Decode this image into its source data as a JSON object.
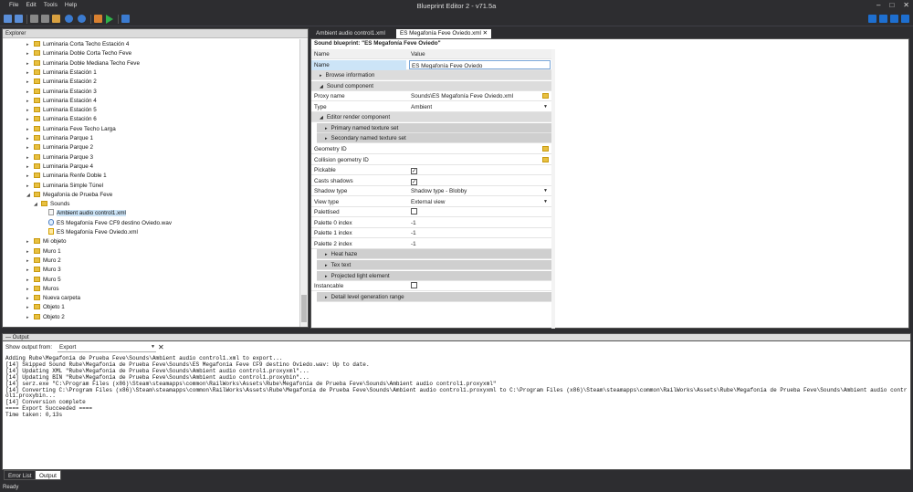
{
  "app": {
    "title": "Blueprint Editor 2 - v71.5a"
  },
  "menu": [
    "File",
    "Edit",
    "Tools",
    "Help"
  ],
  "explorer": {
    "title": "Explorer",
    "items": [
      {
        "label": "Luminaria Corta Techo Estación 4",
        "indent": 1,
        "type": "folder",
        "arrow": "▸"
      },
      {
        "label": "Luminaria Doble Corta Techo Feve",
        "indent": 1,
        "type": "folder",
        "arrow": "▸"
      },
      {
        "label": "Luminaria Doble Mediana Techo Feve",
        "indent": 1,
        "type": "folder",
        "arrow": "▸"
      },
      {
        "label": "Luminaria Estación 1",
        "indent": 1,
        "type": "folder",
        "arrow": "▸"
      },
      {
        "label": "Luminaria Estación 2",
        "indent": 1,
        "type": "folder",
        "arrow": "▸"
      },
      {
        "label": "Luminaria Estación 3",
        "indent": 1,
        "type": "folder",
        "arrow": "▸"
      },
      {
        "label": "Luminaria Estación 4",
        "indent": 1,
        "type": "folder",
        "arrow": "▸"
      },
      {
        "label": "Luminaria Estación 5",
        "indent": 1,
        "type": "folder",
        "arrow": "▸"
      },
      {
        "label": "Luminaria Estación 6",
        "indent": 1,
        "type": "folder",
        "arrow": "▸"
      },
      {
        "label": "Luminaria Feve Techo Larga",
        "indent": 1,
        "type": "folder",
        "arrow": "▸"
      },
      {
        "label": "Luminaria Parque 1",
        "indent": 1,
        "type": "folder",
        "arrow": "▸"
      },
      {
        "label": "Luminaria Parque 2",
        "indent": 1,
        "type": "folder",
        "arrow": "▸"
      },
      {
        "label": "Luminaria Parque 3",
        "indent": 1,
        "type": "folder",
        "arrow": "▸"
      },
      {
        "label": "Luminaria Parque 4",
        "indent": 1,
        "type": "folder",
        "arrow": "▸"
      },
      {
        "label": "Luminaria Renfe Doble 1",
        "indent": 1,
        "type": "folder",
        "arrow": "▸"
      },
      {
        "label": "Luminaria Simple Túnel",
        "indent": 1,
        "type": "folder",
        "arrow": "▸"
      },
      {
        "label": "Megafonía de Prueba Feve",
        "indent": 1,
        "type": "folder",
        "arrow": "◢"
      },
      {
        "label": "Sounds",
        "indent": 2,
        "type": "folder",
        "arrow": "◢"
      },
      {
        "label": "Ambient audio control1.xml",
        "indent": 3,
        "type": "file",
        "arrow": "",
        "selected": true
      },
      {
        "label": "ES Megafonía Feve CF9 destino Oviedo.wav",
        "indent": 3,
        "type": "wav",
        "arrow": ""
      },
      {
        "label": "ES Megafonía Feve Oviedo.xml",
        "indent": 3,
        "type": "xmlo",
        "arrow": ""
      },
      {
        "label": "Mi objeto",
        "indent": 1,
        "type": "folder",
        "arrow": "▸"
      },
      {
        "label": "Muro 1",
        "indent": 1,
        "type": "folder",
        "arrow": "▸"
      },
      {
        "label": "Muro 2",
        "indent": 1,
        "type": "folder",
        "arrow": "▸"
      },
      {
        "label": "Muro 3",
        "indent": 1,
        "type": "folder",
        "arrow": "▸"
      },
      {
        "label": "Muro 5",
        "indent": 1,
        "type": "folder",
        "arrow": "▸"
      },
      {
        "label": "Muros",
        "indent": 1,
        "type": "folder",
        "arrow": "▸"
      },
      {
        "label": "Nueva carpeta",
        "indent": 1,
        "type": "folder",
        "arrow": "▸"
      },
      {
        "label": "Objeto 1",
        "indent": 1,
        "type": "folder",
        "arrow": "▸"
      },
      {
        "label": "Objeto 2",
        "indent": 1,
        "type": "folder",
        "arrow": "▸"
      }
    ]
  },
  "tabs": [
    {
      "label": "Ambient audio control1.xml",
      "active": false
    },
    {
      "label": "ES Megafonía Feve Oviedo.xml",
      "active": true,
      "close": "✕"
    }
  ],
  "blueprint": {
    "header": "Sound blueprint: \"ES Megafonía Feve Oviedo\"",
    "col_name": "Name",
    "col_value": "Value",
    "rows": [
      {
        "kind": "prop",
        "name": "Name",
        "value": "ES Megafonía Feve Oviedo",
        "highlight": true
      },
      {
        "kind": "cat",
        "name": "Browse information",
        "arrow": "▸"
      },
      {
        "kind": "cat",
        "name": "Sound component",
        "arrow": "◢"
      },
      {
        "kind": "prop",
        "name": "Proxy name",
        "value": "Sounds\\ES Megafonía Feve Oviedo.xml",
        "icon": "folder"
      },
      {
        "kind": "prop",
        "name": "Type",
        "value": "Ambient",
        "dropdown": true
      },
      {
        "kind": "cat",
        "name": "Editor render component",
        "arrow": "◢"
      },
      {
        "kind": "subcat",
        "name": "Primary named texture set",
        "arrow": "▸"
      },
      {
        "kind": "subcat",
        "name": "Secondary named texture set",
        "arrow": "▸"
      },
      {
        "kind": "prop",
        "name": "Geometry ID",
        "value": "",
        "icon": "folder"
      },
      {
        "kind": "prop",
        "name": "Collision geometry ID",
        "value": "",
        "icon": "folder"
      },
      {
        "kind": "prop",
        "name": "Pickable",
        "checkbox": true,
        "checked": true
      },
      {
        "kind": "prop",
        "name": "Casts shadows",
        "checkbox": true,
        "checked": true
      },
      {
        "kind": "prop",
        "name": "Shadow type",
        "value": "Shadow type - Blobby",
        "dropdown": true
      },
      {
        "kind": "prop",
        "name": "View type",
        "value": "External view",
        "dropdown": true
      },
      {
        "kind": "prop",
        "name": "Palettised",
        "checkbox": true,
        "checked": false
      },
      {
        "kind": "prop",
        "name": "Palette 0 index",
        "value": "-1"
      },
      {
        "kind": "prop",
        "name": "Palette 1 index",
        "value": "-1"
      },
      {
        "kind": "prop",
        "name": "Palette 2 index",
        "value": "-1"
      },
      {
        "kind": "subcat",
        "name": "Heat haze",
        "arrow": "▸"
      },
      {
        "kind": "subcat",
        "name": "Tex text",
        "arrow": "▸"
      },
      {
        "kind": "subcat",
        "name": "Projected light element",
        "arrow": "▸"
      },
      {
        "kind": "prop",
        "name": "Instancable",
        "checkbox": true,
        "checked": false
      },
      {
        "kind": "subcat",
        "name": "Detail level generation range",
        "arrow": "▸"
      }
    ]
  },
  "output": {
    "title": "Output",
    "show_label": "Show output from:",
    "source": "Export",
    "log": "Adding Rube\\Megafonía de Prueba Feve\\Sounds\\Ambient audio control1.xml to export...\n[14] Skipped Sound Rube\\Megafonía de Prueba Feve\\Sounds\\ES Megafonía Feve CF9 destino Oviedo.wav: Up to date.\n[14] Updating XML \"Rube\\Megafonía de Prueba Feve\\Sounds\\Ambient audio control1.proxyxml\"...\n[14] Updating BIN \"Rube\\Megafonía de Prueba Feve\\Sounds\\Ambient audio control1.proxybin\"...\n[14] serz.exe \"C:\\Program Files (x86)\\Steam\\steamapps\\common\\RailWorks\\Assets\\Rube\\Megafonía de Prueba Feve\\Sounds\\Ambient audio control1.proxyxml\"\n[14] Converting C:\\Program Files (x86)\\Steam\\steamapps\\common\\RailWorks\\Assets\\Rube\\Megafonía de Prueba Feve\\Sounds\\Ambient audio control1.proxyxml to C:\\Program Files (x86)\\Steam\\steamapps\\common\\RailWorks\\Assets\\Rube\\Megafonía de Prueba Feve\\Sounds\\Ambient audio control1.proxybin...\n[14] Conversion complete\n==== Export Succeeded ====\nTime taken: 0,13s"
  },
  "bottom_tabs": [
    {
      "label": "Error List",
      "active": false
    },
    {
      "label": "Output",
      "active": true
    }
  ],
  "status": "Ready"
}
